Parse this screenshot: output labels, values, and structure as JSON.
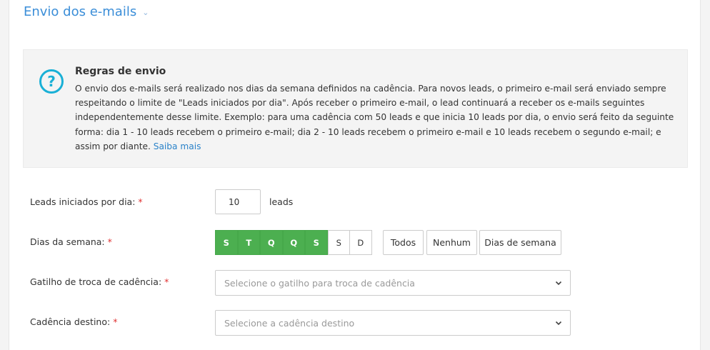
{
  "section": {
    "title": "Envio dos e-mails"
  },
  "info": {
    "title": "Regras de envio",
    "text": "O envio dos e-mails será realizado nos dias da semana definidos na cadência. Para novos leads, o primeiro e-mail será enviado sempre respeitando o limite de \"Leads iniciados por dia\". Após receber o primeiro e-mail, o lead continuará a receber os e-mails seguintes independentemente desse limite. Exemplo: para uma cadência com 50 leads e que inicia 10 leads por dia, o envio será feito da seguinte forma: dia 1 - 10 leads recebem o primeiro e-mail; dia 2 - 10 leads recebem o primeiro e-mail e 10 leads recebem o segundo e-mail; e assim por diante.",
    "link": "Saiba mais"
  },
  "form": {
    "required_mark": "*",
    "leads_per_day": {
      "label": "Leads iniciados por dia:",
      "value": "10",
      "unit": "leads"
    },
    "weekdays": {
      "label": "Dias da semana:",
      "days": [
        {
          "label": "S",
          "selected": true
        },
        {
          "label": "T",
          "selected": true
        },
        {
          "label": "Q",
          "selected": true
        },
        {
          "label": "Q",
          "selected": true
        },
        {
          "label": "S",
          "selected": true
        },
        {
          "label": "S",
          "selected": false
        },
        {
          "label": "D",
          "selected": false
        }
      ],
      "all_label": "Todos",
      "none_label": "Nenhum",
      "weekdays_label": "Dias de semana"
    },
    "trigger": {
      "label": "Gatilho de troca de cadência:",
      "placeholder": "Selecione o gatilho para troca de cadência"
    },
    "destination": {
      "label": "Cadência destino:",
      "placeholder": "Selecione a cadência destino"
    }
  },
  "colors": {
    "accent": "#3b8ed8",
    "selected_day": "#4caf50",
    "info_icon": "#1ab0d6",
    "required": "#e03131"
  }
}
